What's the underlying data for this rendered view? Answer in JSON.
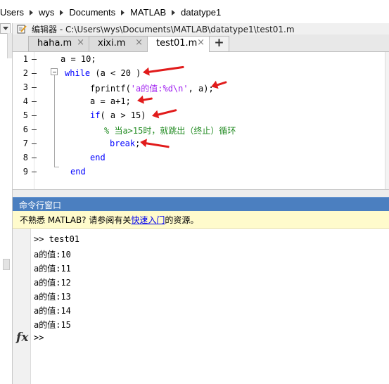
{
  "address_bar": {
    "crumbs": [
      "Users",
      "wys",
      "Documents",
      "MATLAB",
      "datatype1"
    ]
  },
  "editor": {
    "title_prefix": "编辑器",
    "title_path": "C:\\Users\\wys\\Documents\\MATLAB\\datatype1\\test01.m",
    "title_sep": " - ",
    "tabs": [
      {
        "label": "haha.m",
        "close": "×",
        "active": false
      },
      {
        "label": "xixi.m",
        "close": "×",
        "active": false
      },
      {
        "label": "test01.m",
        "close": "×",
        "active": true
      }
    ],
    "add_tab": "+",
    "line_numbers": [
      "1",
      "2",
      "3",
      "4",
      "5",
      "6",
      "7",
      "8",
      "9"
    ],
    "code": {
      "l1": "a = 10;",
      "l2_kw": "while",
      "l2_rest": " (a < 20 )",
      "l3_a": "fprintf(",
      "l3_str": "'a的值:%d\\n'",
      "l3_b": ", a);",
      "l4": "a = a+1;",
      "l5_kw": "if",
      "l5_rest": "( a > 15)",
      "l6_cmt": "% 当a>15时，就跳出（终止）循环",
      "l7_kw": "break",
      "l7_rest": ";",
      "l8_kw": "end",
      "l9_kw": "end"
    }
  },
  "command_window": {
    "title": "命令行窗口",
    "notice_before": "不熟悉 MATLAB? 请参阅有关",
    "notice_link": "快速入门",
    "notice_after": "的资源。",
    "lines": [
      ">> test01",
      "a的值:10",
      "a的值:11",
      "a的值:12",
      "a的值:13",
      "a的值:14",
      "a的值:15"
    ],
    "prompt": ">>",
    "fx_label": "fx"
  },
  "colors": {
    "keyword": "#0000ff",
    "string": "#a020f0",
    "comment": "#228b22",
    "annotation_arrow": "#e11b1b",
    "cmd_title_bar": "#4b7fc0",
    "notice_bg": "#fffbcc"
  }
}
